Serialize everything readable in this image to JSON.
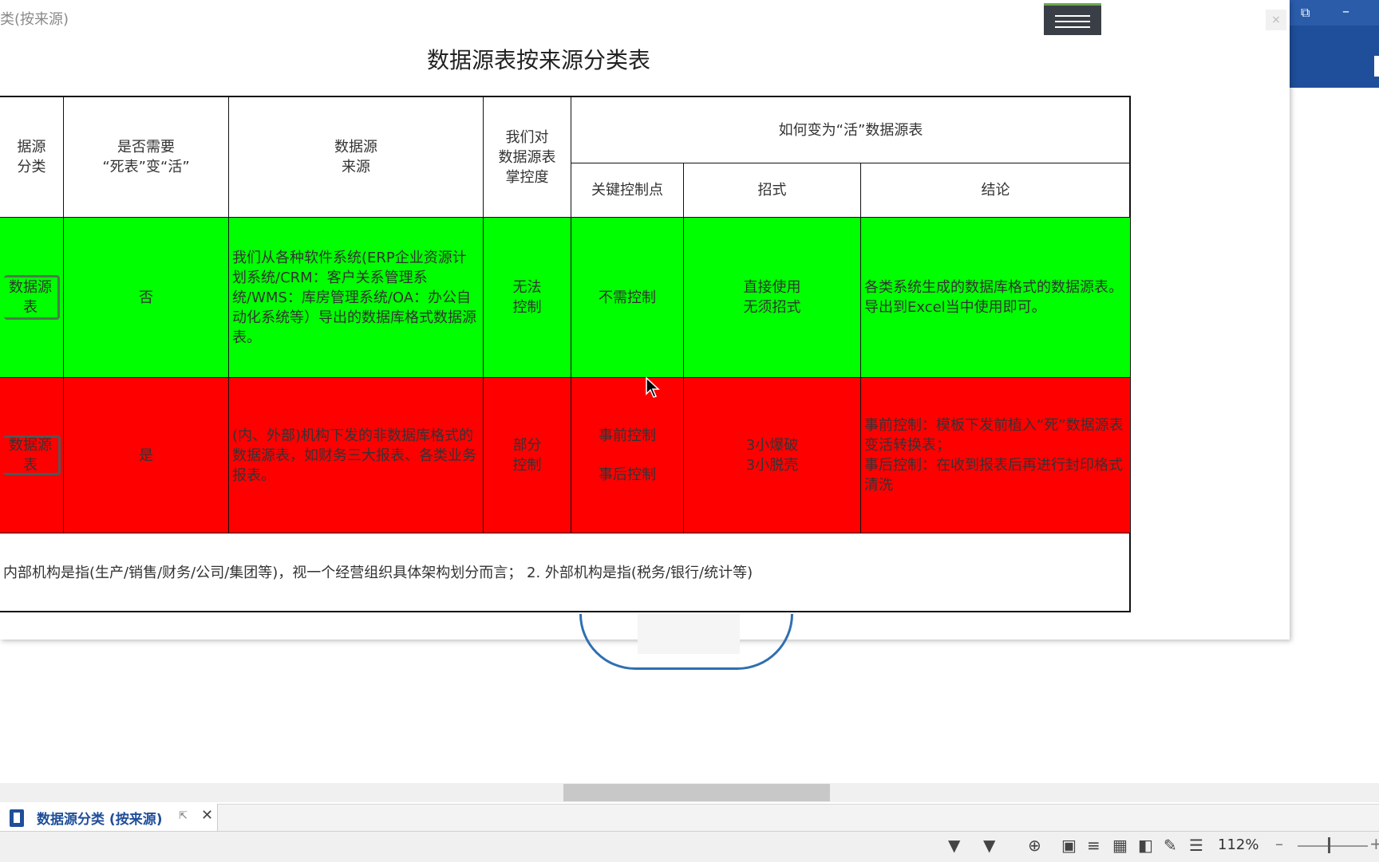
{
  "window": {
    "caption": "类(按来源)",
    "close_glyph": "×",
    "restore_glyph": "⧉",
    "minimize_glyph": "–"
  },
  "sheet": {
    "title": "数据源表按来源分类表",
    "headers": {
      "col1": "据源\n分类",
      "col2": "是否需要\n“死表”变“活”",
      "col3": "数据源\n来源",
      "col4": "我们对\n数据源表\n掌控度",
      "group": "如何变为“活”数据源表",
      "sub1": "关键控制点",
      "sub2": "招式",
      "sub3": "结论"
    },
    "rows": [
      {
        "category": "数据源表",
        "need_convert": "否",
        "source": "我们从各种软件系统(ERP企业资源计划系统/CRM：客户关系管理系统/WMS：库房管理系统/OA：办公自动化系统等）导出的数据库格式数据源表。",
        "control": "无法\n控制",
        "key_point": "不需控制",
        "method": "直接使用\n无须招式",
        "conclusion": "各类系统生成的数据库格式的数据源表。导出到Excel当中使用即可。"
      },
      {
        "category": "数据源表",
        "need_convert": "是",
        "source": "(内、外部)机构下发的非数据库格式的数据源表，如财务三大报表、各类业务报表。",
        "control": "部分\n控制",
        "key_point_a": "事前控制",
        "key_point_b": "事后控制",
        "method": "3小爆破\n3小脱壳",
        "conclusion": "事前控制：模板下发前植入“死”数据源表变活转换表；\n事后控制：在收到报表后再进行封印格式清洗"
      }
    ],
    "footnote": "内部机构是指(生产/销售/财务/公司/集团等)，视一个经营组织具体架构划分而言；   2. 外部机构是指(税务/银行/统计等)"
  },
  "tabs": {
    "active_label": "数据源分类 (按来源)",
    "popout_glyph": "⇱",
    "close_glyph": "✕"
  },
  "status": {
    "zoom": "112%",
    "zoom_minus": "–",
    "zoom_plus": "+"
  },
  "colors": {
    "green_row": "#00ff00",
    "red_row": "#ff0000",
    "brand_blue": "#1f4e9a"
  }
}
